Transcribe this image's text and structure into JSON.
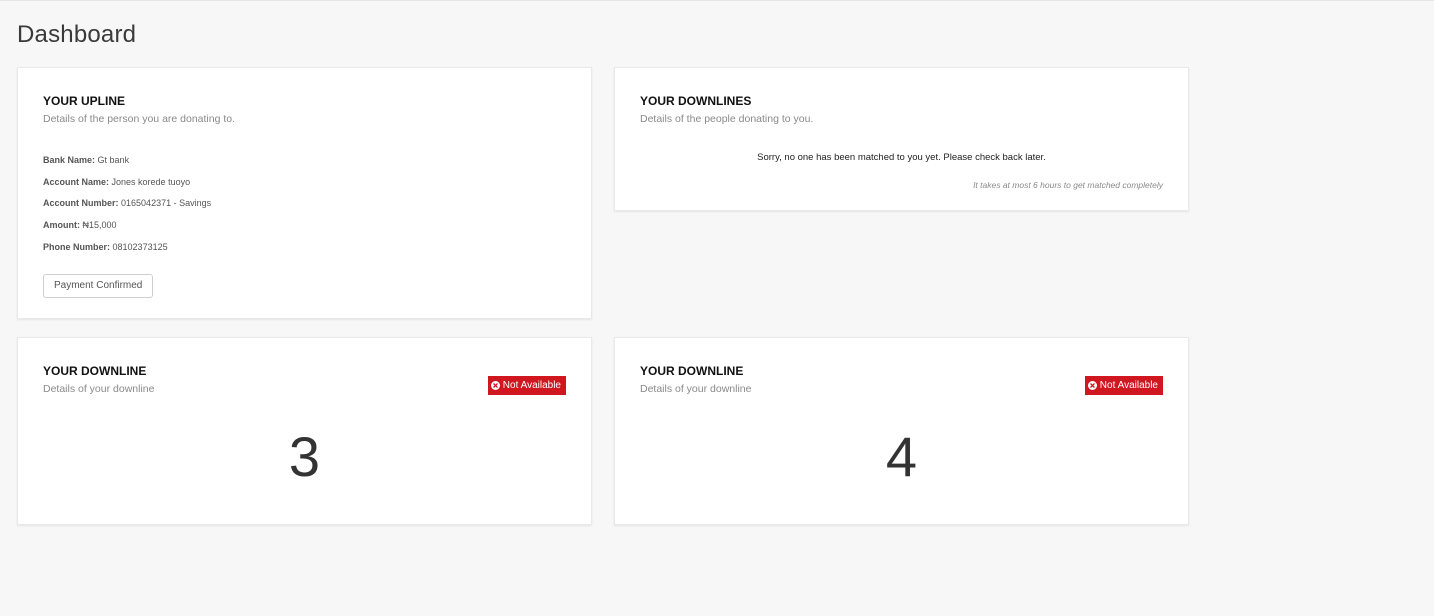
{
  "page": {
    "title": "Dashboard"
  },
  "upline": {
    "title": "YOUR UPLINE",
    "subtitle": "Details of the person you are donating to.",
    "details": [
      {
        "label": "Bank Name:",
        "value": "Gt bank"
      },
      {
        "label": "Account Name:",
        "value": "Jones korede tuoyo"
      },
      {
        "label": "Account Number:",
        "value": "0165042371 - Savings"
      },
      {
        "label": "Amount:",
        "value": "₦15,000"
      },
      {
        "label": "Phone Number:",
        "value": "08102373125"
      }
    ],
    "button_label": "Payment Confirmed"
  },
  "downlines": {
    "title": "YOUR DOWNLINES",
    "subtitle": "Details of the people donating to you.",
    "empty_message": "Sorry, no one has been matched to you yet. Please check back later.",
    "note": "It takes at most 6 hours to get matched completely"
  },
  "downline_cards": [
    {
      "title": "YOUR DOWNLINE",
      "subtitle": "Details of your downline",
      "badge": "Not Available",
      "number": "3"
    },
    {
      "title": "YOUR DOWNLINE",
      "subtitle": "Details of your downline",
      "badge": "Not Available",
      "number": "4"
    }
  ],
  "colors": {
    "background": "#f7f7f7",
    "badge": "#d0161f",
    "card": "#ffffff"
  },
  "icons": {
    "badge_icon": "times-circle-icon"
  }
}
